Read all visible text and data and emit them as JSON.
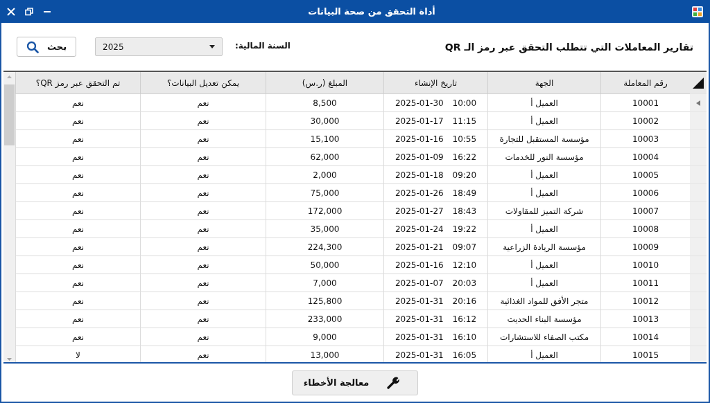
{
  "window": {
    "title": "أداة التحقق من صحة البيانات"
  },
  "toolbar": {
    "heading": "تقارير المعاملات التي تتطلب التحقق عبر رمز الـ QR",
    "year_label": "السنة المالية:",
    "year_select": {
      "value": "2025"
    },
    "search_button": "بحث"
  },
  "table": {
    "columns": [
      "رقم المعاملة",
      "الجهة",
      "تاريخ الإنشاء",
      "المبلغ (ر.س)",
      "يمكن تعديل البيانات؟",
      "تم التحقق عبر رمز QR؟"
    ],
    "rows": [
      {
        "current": true,
        "cells": [
          "10001",
          "العميل أ",
          "2025-01-30 10:00",
          "8,500",
          "نعم",
          "نعم"
        ]
      },
      {
        "current": false,
        "cells": [
          "10002",
          "العميل أ",
          "2025-01-17 11:15",
          "30,000",
          "نعم",
          "نعم"
        ]
      },
      {
        "current": false,
        "cells": [
          "10003",
          "مؤسسة المستقبل للتجارة",
          "2025-01-16 10:55",
          "15,100",
          "نعم",
          "نعم"
        ]
      },
      {
        "current": false,
        "cells": [
          "10004",
          "مؤسسة النور للخدمات",
          "2025-01-09 16:22",
          "62,000",
          "نعم",
          "نعم"
        ]
      },
      {
        "current": false,
        "cells": [
          "10005",
          "العميل أ",
          "2025-01-18 09:20",
          "2,000",
          "نعم",
          "نعم"
        ]
      },
      {
        "current": false,
        "cells": [
          "10006",
          "العميل أ",
          "2025-01-26 18:49",
          "75,000",
          "نعم",
          "نعم"
        ]
      },
      {
        "current": false,
        "cells": [
          "10007",
          "شركة التميز للمقاولات",
          "2025-01-27 18:43",
          "172,000",
          "نعم",
          "نعم"
        ]
      },
      {
        "current": false,
        "cells": [
          "10008",
          "العميل أ",
          "2025-01-24 19:22",
          "35,000",
          "نعم",
          "نعم"
        ]
      },
      {
        "current": false,
        "cells": [
          "10009",
          "مؤسسة الريادة الزراعية",
          "2025-01-21 09:07",
          "224,300",
          "نعم",
          "نعم"
        ]
      },
      {
        "current": false,
        "cells": [
          "10010",
          "العميل أ",
          "2025-01-16 12:10",
          "50,000",
          "نعم",
          "نعم"
        ]
      },
      {
        "current": false,
        "cells": [
          "10011",
          "العميل أ",
          "2025-01-07 20:03",
          "7,000",
          "نعم",
          "نعم"
        ]
      },
      {
        "current": false,
        "cells": [
          "10012",
          "متجر الأفق للمواد الغذائية",
          "2025-01-31 20:16",
          "125,800",
          "نعم",
          "نعم"
        ]
      },
      {
        "current": false,
        "cells": [
          "10013",
          "مؤسسة البناء الحديث",
          "2025-01-31 16:12",
          "233,000",
          "نعم",
          "نعم"
        ]
      },
      {
        "current": false,
        "cells": [
          "10014",
          "مكتب الصفاء للاستشارات",
          "2025-01-31 16:10",
          "9,000",
          "نعم",
          "نعم"
        ]
      },
      {
        "current": false,
        "cells": [
          "10015",
          "العميل أ",
          "2025-01-31 16:05",
          "13,000",
          "نعم",
          "لا"
        ]
      }
    ]
  },
  "footer": {
    "button": "معالجة الأخطاء"
  }
}
